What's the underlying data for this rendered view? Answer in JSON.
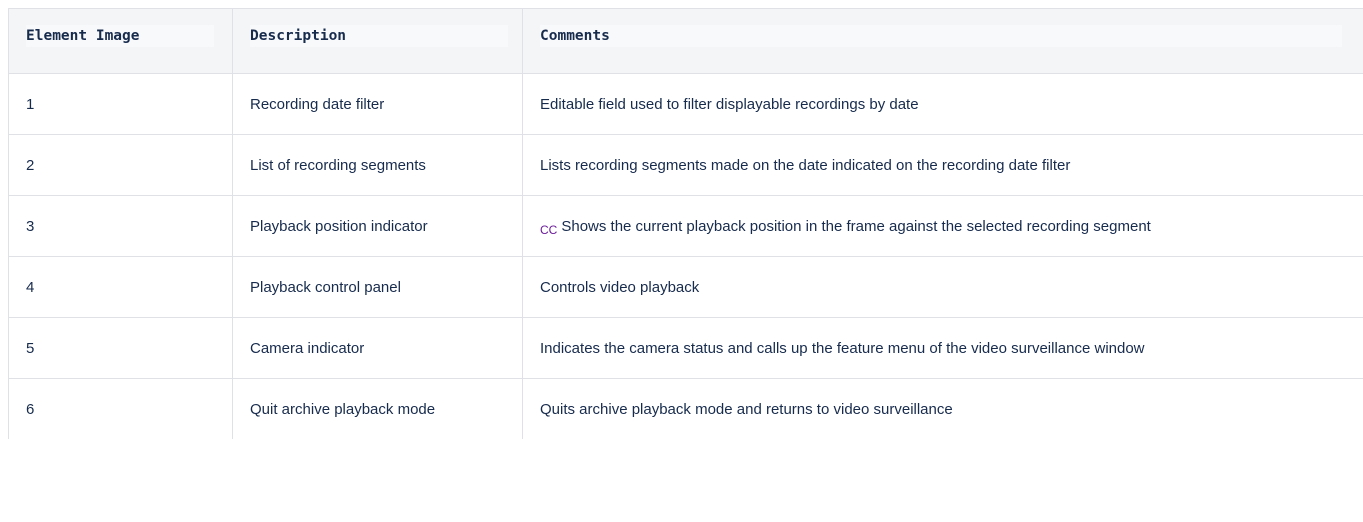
{
  "table": {
    "headers": [
      "Element Image",
      "Description",
      "Comments"
    ],
    "rows": [
      {
        "num": "1",
        "description": "Recording date filter",
        "prefix": "",
        "comment": "Editable field used to filter displayable recordings by date"
      },
      {
        "num": "2",
        "description": "List of recording segments",
        "prefix": "",
        "comment": "Lists recording segments made on the date indicated on the recording date filter"
      },
      {
        "num": "3",
        "description": "Playback position indicator",
        "prefix": "CC",
        "comment": "Shows the current playback position in the frame against the selected recording segment"
      },
      {
        "num": "4",
        "description": "Playback control panel",
        "prefix": "",
        "comment": "Controls video playback"
      },
      {
        "num": "5",
        "description": "Camera indicator",
        "prefix": "",
        "comment": "Indicates the camera status and calls up the feature menu of the video surveillance window"
      },
      {
        "num": "6",
        "description": "Quit archive playback mode",
        "prefix": "",
        "comment": "Quits archive playback mode and returns to video surveillance"
      }
    ]
  },
  "colors": {
    "header_bg": "#f4f5f7",
    "border": "#dfe1e6",
    "text": "#172b4d",
    "cc_marker": "#6a1b9a"
  }
}
